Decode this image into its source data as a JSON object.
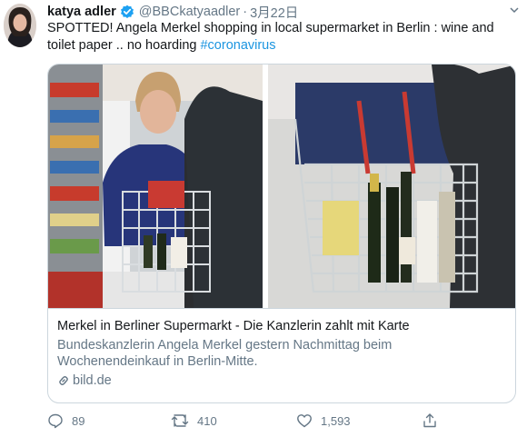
{
  "tweet": {
    "author": {
      "display_name": "katya adler",
      "handle": "@BBCkatyaadler",
      "verified": true
    },
    "separator": "·",
    "date": "3月22日",
    "text_main": "SPOTTED! Angela Merkel shopping in local supermarket in Berlin : wine and toilet paper .. no hoarding ",
    "hashtag": "#coronavirus"
  },
  "card": {
    "title": "Merkel in Berliner Supermarkt - Die Kanzlerin zahlt mit Karte",
    "description": "Bundeskanzlerin Angela Merkel gestern Nachmittag beim Wochenendeinkauf in Berlin-Mitte.",
    "domain": "bild.de"
  },
  "actions": {
    "replies": "89",
    "retweets": "410",
    "likes": "1,593"
  },
  "icons": {
    "verified": "verified-badge-icon",
    "caret": "chevron-down-icon",
    "link": "link-icon",
    "reply": "reply-icon",
    "retweet": "retweet-icon",
    "like": "heart-icon",
    "share": "share-icon"
  },
  "colors": {
    "text": "#14171a",
    "secondary": "#657786",
    "link": "#1b95e0",
    "border": "#ccd6dd"
  }
}
